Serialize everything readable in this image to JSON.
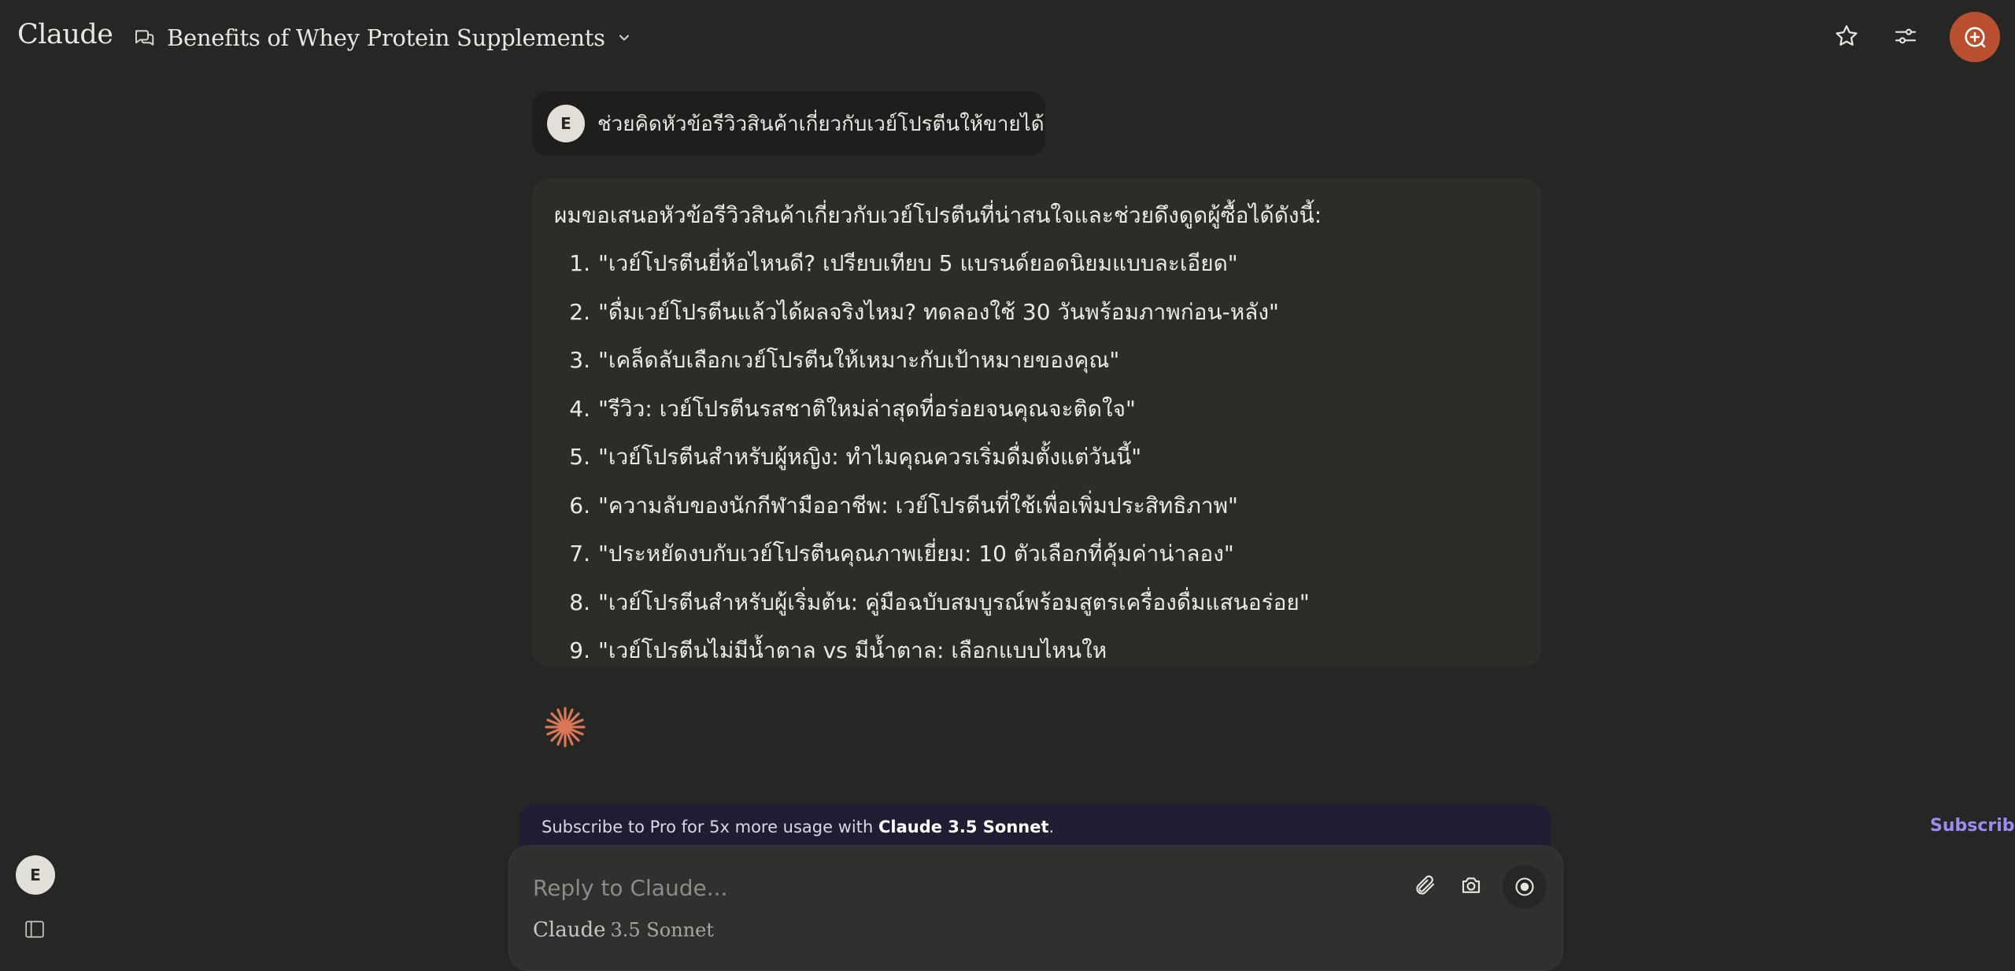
{
  "app": {
    "logo": "Claude",
    "conversation_title": "Benefits of Whey Protein Supplements"
  },
  "user_message": {
    "avatar_initial": "E",
    "text": "ช่วยคิดหัวข้อรีวิวสินค้าเกี่ยวกับเวย์โปรตีนให้ขายได้"
  },
  "assistant_message": {
    "intro": "ผมขอเสนอหัวข้อรีวิวสินค้าเกี่ยวกับเวย์โปรตีนที่น่าสนใจและช่วยดึงดูดผู้ซื้อได้ดังนี้:",
    "items": [
      {
        "num": "1.",
        "text": "\"เวย์โปรตีนยี่ห้อไหนดี? เปรียบเทียบ 5 แบรนด์ยอดนิยมแบบละเอียด\""
      },
      {
        "num": "2.",
        "text": "\"ดื่มเวย์โปรตีนแล้วได้ผลจริงไหม? ทดลองใช้ 30 วันพร้อมภาพก่อน-หลัง\""
      },
      {
        "num": "3.",
        "text": "\"เคล็ดลับเลือกเวย์โปรตีนให้เหมาะกับเป้าหมายของคุณ\""
      },
      {
        "num": "4.",
        "text": "\"รีวิว: เวย์โปรตีนรสชาติใหม่ล่าสุดที่อร่อยจนคุณจะติดใจ\""
      },
      {
        "num": "5.",
        "text": "\"เวย์โปรตีนสำหรับผู้หญิง: ทำไมคุณควรเริ่มดื่มตั้งแต่วันนี้\""
      },
      {
        "num": "6.",
        "text": "\"ความลับของนักกีฬามืออาชีพ: เวย์โปรตีนที่ใช้เพื่อเพิ่มประสิทธิภาพ\""
      },
      {
        "num": "7.",
        "text": "\"ประหยัดงบกับเวย์โปรตีนคุณภาพเยี่ยม: 10 ตัวเลือกที่คุ้มค่าน่าลอง\""
      },
      {
        "num": "8.",
        "text": "\"เวย์โปรตีนสำหรับผู้เริ่มต้น: คู่มือฉบับสมบูรณ์พร้อมสูตรเครื่องดื่มแสนอร่อย\""
      },
      {
        "num": "9.",
        "text": "\"เวย์โปรตีนไม่มีน้ำตาล vs มีน้ำตาล: เลือกแบบไหนให"
      }
    ]
  },
  "banner": {
    "text_prefix": "Subscribe to Pro for 5x more usage with ",
    "text_model": "Claude 3.5 Sonnet",
    "text_suffix": ".",
    "subscribe_label": "Subscribe"
  },
  "composer": {
    "placeholder": "Reply to Claude...",
    "model_brand": "Claude",
    "model_version": "3.5 Sonnet"
  },
  "sidebar": {
    "avatar_initial": "E"
  },
  "colors": {
    "background": "#262624",
    "accent_orange": "#b8502f",
    "spark": "#d97757",
    "subscribe_link": "#9d8cf0",
    "banner_bg": "#1f1d33"
  },
  "icons": {
    "chat": "chat-bubbles-icon",
    "dropdown": "chevron-down-icon",
    "star": "star-icon",
    "settings": "sliders-icon",
    "new_chat": "new-chat-icon",
    "close": "close-icon",
    "attach": "paperclip-icon",
    "camera": "camera-icon",
    "record": "record-icon",
    "sidebar": "sidebar-toggle-icon",
    "spark": "claude-spark-icon"
  }
}
